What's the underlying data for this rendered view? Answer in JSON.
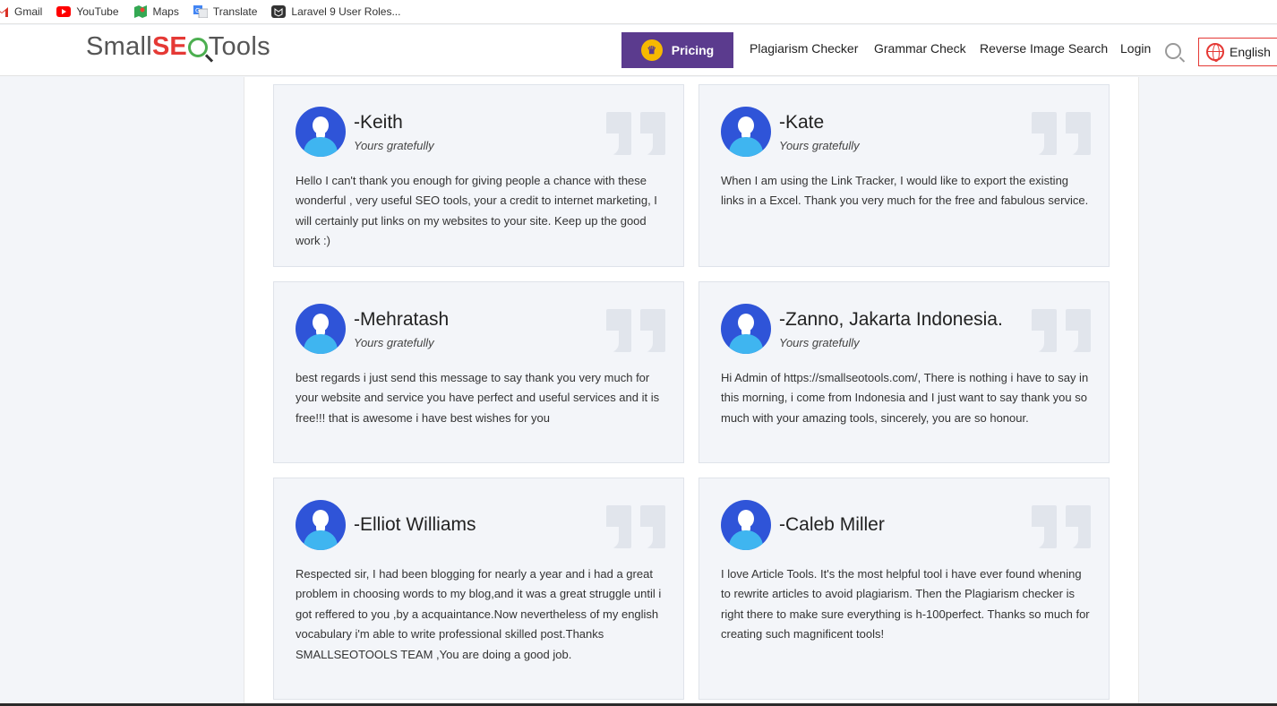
{
  "bookmarks": [
    {
      "label": "Gmail",
      "icon": "gmail-icon",
      "color": "#d93025"
    },
    {
      "label": "YouTube",
      "icon": "youtube-icon",
      "color": "#ff0000"
    },
    {
      "label": "Maps",
      "icon": "maps-icon",
      "color": "#34a853"
    },
    {
      "label": "Translate",
      "icon": "translate-icon",
      "color": "#4285f4"
    },
    {
      "label": "Laravel 9 User Roles...",
      "icon": "laravel-icon",
      "color": "#333333"
    }
  ],
  "header": {
    "logo": {
      "part1": "Small",
      "part2": "SE",
      "part3": "Tools"
    },
    "pricing_label": "Pricing",
    "nav": [
      "Plagiarism Checker",
      "Grammar Check",
      "Reverse Image Search",
      "Login"
    ],
    "language": "English"
  },
  "testimonials": [
    {
      "name": "-Keith",
      "subtitle": "Yours gratefully",
      "text": "Hello I can't thank you enough for giving people a chance with these wonderful , very useful SEO tools, your a credit to internet marketing, I will certainly put links on my websites to your site. Keep up the good work :)"
    },
    {
      "name": "-Kate",
      "subtitle": "Yours gratefully",
      "text": "When I am using the Link Tracker, I would like to export the existing links in a Excel. Thank you very much for the free and fabulous service."
    },
    {
      "name": "-Mehratash",
      "subtitle": "Yours gratefully",
      "text": "best regards i just send this message to say thank you very much for your website and service you have perfect and useful services and it is free!!! that is awesome i have best wishes for you"
    },
    {
      "name": "-Zanno, Jakarta Indonesia.",
      "subtitle": "Yours gratefully",
      "text": "Hi Admin of https://smallseotools.com/, There is nothing i have to say in this morning, i come from Indonesia and I just want to say thank you so much with your amazing tools, sincerely, you are so honour."
    },
    {
      "name": "-Elliot Williams",
      "subtitle": "",
      "text": "Respected sir, I had been blogging for nearly a year and i had a great problem in choosing words to my blog,and it was a great struggle until i got reffered to you ,by a acquaintance.Now nevertheless of my english vocabulary i'm able to write professional skilled post.Thanks SMALLSEOTOOLS TEAM ,You are doing a good job."
    },
    {
      "name": "-Caleb Miller",
      "subtitle": "",
      "text": "I love Article Tools. It's the most helpful tool i have ever found whening to rewrite articles to avoid plagiarism. Then the Plagiarism checker is right there to make sure everything is h-100perfect. Thanks so much for creating such magnificent tools!"
    }
  ]
}
